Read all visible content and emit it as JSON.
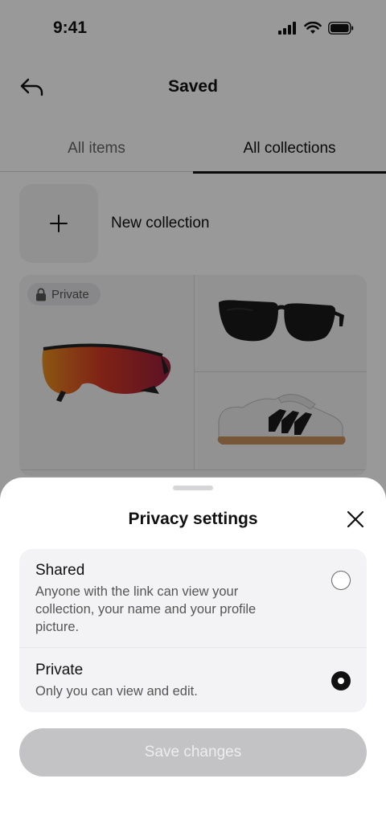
{
  "status_bar": {
    "time": "9:41",
    "icons": [
      "cellular-signal-icon",
      "wifi-icon",
      "battery-icon"
    ]
  },
  "header": {
    "title": "Saved",
    "back_icon": "back-arrow-icon"
  },
  "tabs": [
    {
      "label": "All items",
      "active": false
    },
    {
      "label": "All collections",
      "active": true
    }
  ],
  "new_collection": {
    "label": "New collection",
    "icon": "plus-icon"
  },
  "collection_card": {
    "badge_label": "Private",
    "badge_icon": "lock-icon",
    "items": [
      "sport-sunglasses-image",
      "black-sunglasses-image",
      "white-sneaker-image"
    ]
  },
  "sheet": {
    "title": "Privacy settings",
    "close_icon": "close-icon",
    "options": [
      {
        "title": "Shared",
        "description": "Anyone with the link can view your collection, your name and your profile picture.",
        "selected": false
      },
      {
        "title": "Private",
        "description": "Only you can view and edit.",
        "selected": true
      }
    ],
    "save_label": "Save changes",
    "save_enabled": false
  },
  "colors": {
    "overlay": "#00000066",
    "sheet_background": "#ffffff",
    "option_background": "#f3f3f5",
    "disabled_button": "#c3c3c6",
    "text_primary": "#111111",
    "text_secondary": "#555555"
  }
}
